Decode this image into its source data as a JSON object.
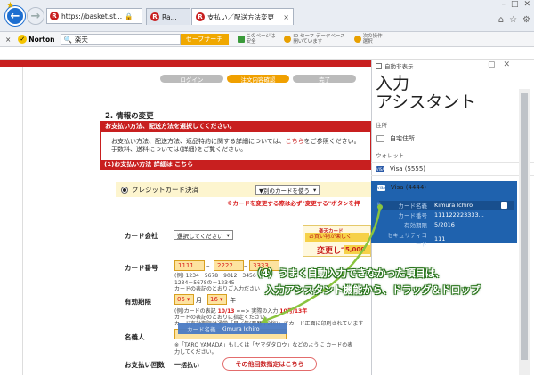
{
  "browser": {
    "address": "https://basket.st...",
    "tab1_label": "Ra...",
    "tab2_label": "支払い／配送方法変更",
    "tab_close": "×",
    "win_controls": [
      "–",
      "□",
      "✕"
    ],
    "toolbar_icons": [
      "home-icon",
      "star-icon",
      "gear-icon"
    ]
  },
  "norton": {
    "close": "×",
    "brand": "Norton",
    "search_value": "楽天",
    "search_button": "セーフサーチ",
    "item1_line1": "このページは",
    "item1_line2": "安全",
    "item2_line1": "ID セーフ データベース",
    "item2_line2": "開いています",
    "item3_line1": "次の操作",
    "item3_line2": "選択"
  },
  "page": {
    "steps": [
      "ログイン",
      "注文内容確認",
      "完了"
    ],
    "active_step": 1,
    "heading": "2. 情報の変更",
    "box1_header": "お支払い方法、配送方法を選択してください。",
    "box1_text_a": "お支払い方法、配送方法、返品特約に関する詳細については、",
    "box1_link": "こちら",
    "box1_text_b": "をご参照ください。",
    "box1_text_c": "手数料、送料については(詳細)をご覧ください。",
    "box2_header_a": "(1)お支払い方法 詳細は",
    "box2_header_link": "こちら",
    "cc_label": "クレジットカード決済",
    "cc_select": "▼別のカードを使う",
    "cc_warn": "※カードを変更する際は必ず\"変更する\"ボタンを押",
    "card_company_label": "カード会社",
    "card_company_select": "選択してください",
    "promo_line1": "楽天カード",
    "promo_line2": "お買い物が楽しく",
    "promo_line3": "変更して",
    "promo_line4": "5,000",
    "card_number_label": "カード番号",
    "card_number_parts": [
      "1111",
      "2222",
      "3333"
    ],
    "card_hint1": "(例) 1234－5678－9012－3456",
    "card_hint2": "1234－5678の－12345",
    "card_hint3": "カードの表記のとおりご入力ださい",
    "expiry_label": "有効期限",
    "expiry_month": "05",
    "expiry_month_unit": "月",
    "expiry_year": "16",
    "expiry_year_unit": "年",
    "exp_hint1_a": "(例)カードの表記 ",
    "exp_hint1_b": "10/13",
    "exp_hint1_c": " ==> 実際の入力 ",
    "exp_hint1_d": "10月/13年",
    "exp_hint2": "カードの表記のとおりに指定ください。",
    "exp_hint3": "カード有効期限は通常「月／年(西暦下2桁)」でカード正面に印刷されています",
    "name_label": "名義人",
    "name_hint1": "※「TARO YAMADA」もしくは「ヤマダタロウ」などのように カードの表",
    "name_hint2": "力してください。",
    "pay_count_label": "お支払い回数",
    "pay_count_value": "一括払い",
    "pay_button": "その他回数指定はこちら"
  },
  "drag_ghost": {
    "key": "カード名義",
    "value": "Kimura Ichiro"
  },
  "panel": {
    "autohide_label": "自動非表示",
    "controls": [
      "▢",
      "✕"
    ],
    "title_line1": "入力",
    "title_line2": "アシスタント",
    "section_address": "住所",
    "home_address": "自宅住所",
    "section_wallet": "ウォレット",
    "visa1": "Visa (5555)",
    "visa2": "Visa (4444)",
    "card_fields": [
      {
        "key": "カード名義",
        "value": "Kimura Ichiro"
      },
      {
        "key": "カード番号",
        "value": "111122223333..."
      },
      {
        "key": "有効期限",
        "value": "5/2016"
      },
      {
        "key": "セキュリティコード",
        "value": "111"
      }
    ]
  },
  "annotation": {
    "line1": "（4）うまく自動入力できなかった項目は、",
    "line2": "入力アシスタント機能から、ドラッグ＆ドロップ"
  },
  "colors": {
    "brand_red": "#c81f1f",
    "panel_selected": "#1f62ae",
    "annotation_green": "#27731a",
    "arrow_green": "#8ac43f"
  }
}
